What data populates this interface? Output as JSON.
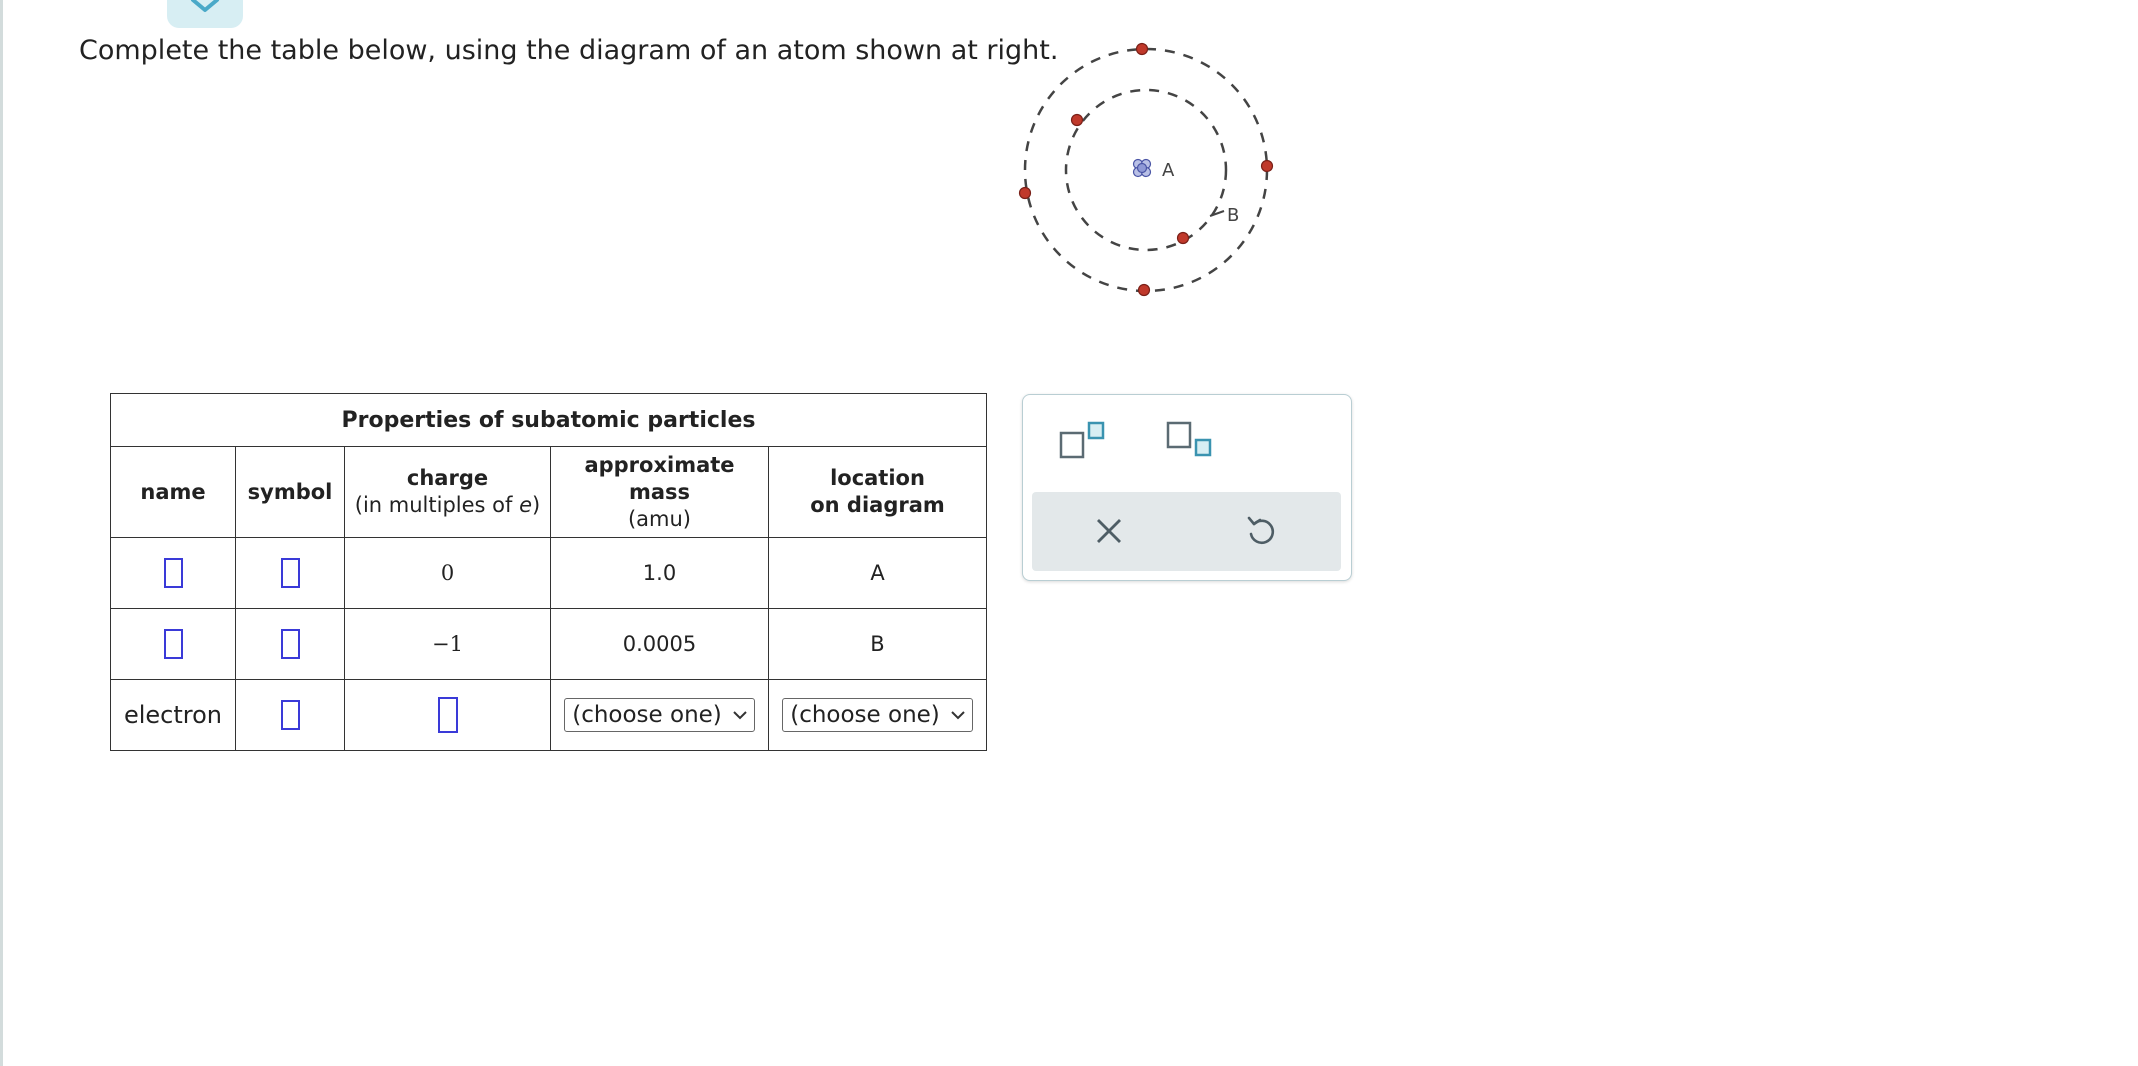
{
  "prompt": "Complete the table below, using the diagram of an atom shown at right.",
  "diagram": {
    "label_a": "A",
    "label_b": "B"
  },
  "table": {
    "caption": "Properties of subatomic particles",
    "headers": {
      "name": "name",
      "symbol": "symbol",
      "charge": "charge",
      "charge_sub_prefix": "(in multiples of ",
      "charge_sub_var": "e",
      "charge_sub_suffix": ")",
      "mass_line1": "approximate",
      "mass_line2": "mass",
      "mass_sub": "(amu)",
      "location_line1": "location",
      "location_line2": "on diagram"
    },
    "rows": [
      {
        "name": "",
        "symbol": "",
        "charge": "0",
        "mass": "1.0",
        "location": "A"
      },
      {
        "name": "",
        "symbol": "",
        "charge": "−1",
        "mass": "0.0005",
        "location": "B"
      },
      {
        "name": "electron",
        "symbol": "",
        "charge": "",
        "mass_select": "(choose one)",
        "location_select": "(choose one)"
      }
    ]
  },
  "toolbar": {
    "superscript_icon": "superscript-icon",
    "subscript_icon": "subscript-icon",
    "clear_icon": "x-icon",
    "undo_icon": "undo-icon"
  },
  "colors": {
    "input_box": "#3a3ad8",
    "electron": "#c0392b",
    "tab_bg": "#d7eef3",
    "accent": "#4aa9c8"
  }
}
